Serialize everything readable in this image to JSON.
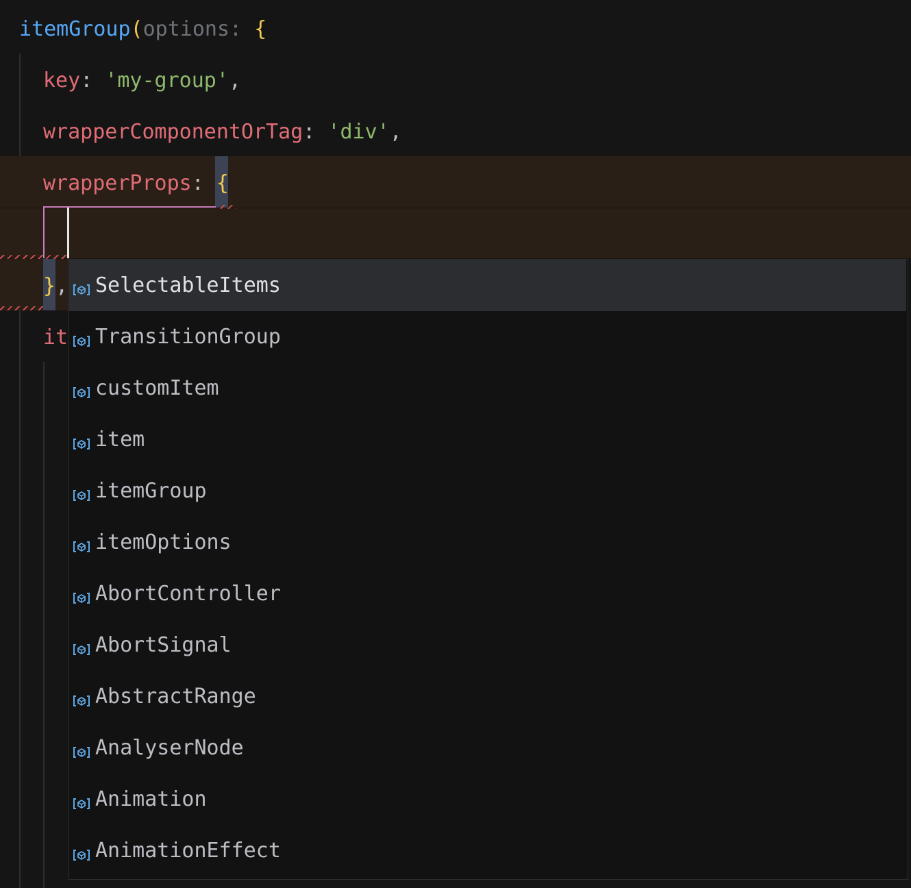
{
  "editor": {
    "line1": {
      "function_name": "itemGroup",
      "open_paren": "(",
      "param_hint": "options:",
      "open_brace": "{"
    },
    "line2": {
      "key": "key",
      "colon": ":",
      "value": "'my-group'",
      "comma": ","
    },
    "line3": {
      "key": "wrapperComponentOrTag",
      "colon": ":",
      "value": "'div'",
      "comma": ","
    },
    "line4": {
      "key": "wrapperProps",
      "colon": ":",
      "open_brace": "{"
    },
    "line6": {
      "close_brace": "}",
      "comma": ","
    },
    "line7": {
      "partial_key": "it"
    }
  },
  "completion": {
    "selected_index": 0,
    "icon": "variable-icon",
    "icon_color": "#5ea8e6",
    "items": [
      "SelectableItems",
      "TransitionGroup",
      "customItem",
      "item",
      "itemGroup",
      "itemOptions",
      "AbortController",
      "AbortSignal",
      "AbstractRange",
      "AnalyserNode",
      "Animation",
      "AnimationEffect"
    ]
  },
  "colors": {
    "background": "#151515",
    "current_line": "#2a1f17",
    "function": "#56a8f5",
    "property": "#e06c75",
    "string": "#8fb96d",
    "brace": "#f2c94c",
    "error_underline": "#c94f4f"
  }
}
